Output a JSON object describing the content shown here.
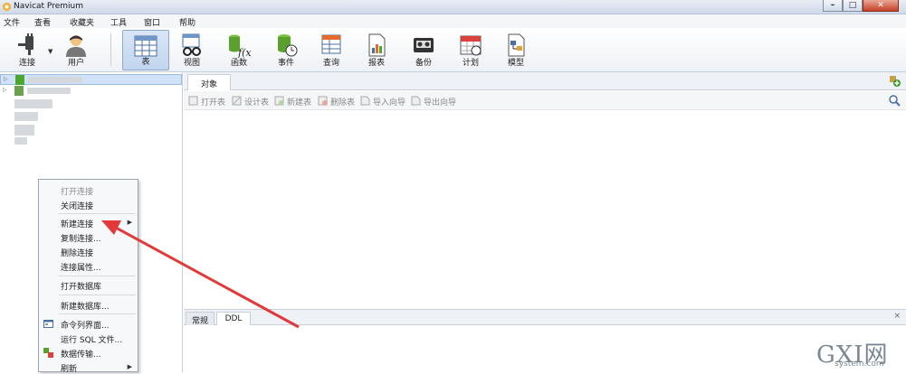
{
  "window": {
    "title": "Navicat Premium",
    "controls": {
      "minimize": "–",
      "restore": "□",
      "close": "✕"
    }
  },
  "menubar": [
    "文件",
    "查看",
    "收藏夹",
    "工具",
    "窗口",
    "帮助"
  ],
  "toolbar": [
    {
      "label": "连接",
      "icon": "plug-icon"
    },
    {
      "label": "用户",
      "icon": "user-icon"
    },
    {
      "label": "表",
      "icon": "table-icon",
      "active": true
    },
    {
      "label": "视图",
      "icon": "view-icon"
    },
    {
      "label": "函数",
      "icon": "function-icon"
    },
    {
      "label": "事件",
      "icon": "event-icon"
    },
    {
      "label": "查询",
      "icon": "query-icon"
    },
    {
      "label": "报表",
      "icon": "report-icon"
    },
    {
      "label": "备份",
      "icon": "backup-icon"
    },
    {
      "label": "计划",
      "icon": "schedule-icon"
    },
    {
      "label": "模型",
      "icon": "model-icon"
    }
  ],
  "object_tab": "对象",
  "object_toolbar": [
    "打开表",
    "设计表",
    "新建表",
    "删除表",
    "导入向导",
    "导出向导"
  ],
  "context_menu": [
    {
      "label": "打开连接",
      "disabled": true
    },
    {
      "label": "关闭连接"
    },
    {
      "label": "新建连接",
      "submenu": true
    },
    {
      "label": "复制连接..."
    },
    {
      "label": "删除连接"
    },
    {
      "label": "连接属性..."
    },
    {
      "label": "打开数据库"
    },
    {
      "label": "新建数据库..."
    },
    {
      "label": "命令列界面...",
      "icon": "console-icon"
    },
    {
      "label": "运行 SQL 文件..."
    },
    {
      "label": "数据传输...",
      "icon": "transfer-icon"
    },
    {
      "label": "刷新",
      "submenu": true
    }
  ],
  "info_tabs": [
    "常规",
    "DDL"
  ],
  "info_close": "×",
  "watermark": {
    "big": "GXI网",
    "small": "system.com"
  },
  "colors": {
    "annotation_arrow": "#e23a3a",
    "selection": "#cfe2f7",
    "active_tool": "#c1d5ee"
  }
}
